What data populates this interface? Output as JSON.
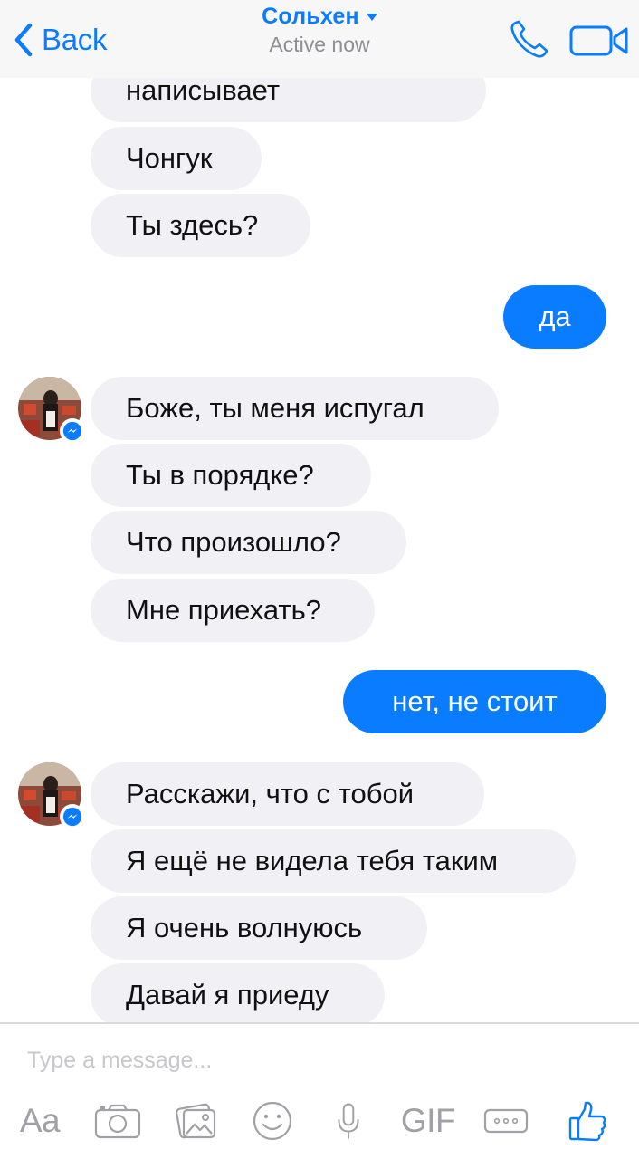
{
  "header": {
    "back_label": "Back",
    "title": "Сольхен",
    "subtitle": "Active now"
  },
  "messages": [
    {
      "side": "in",
      "text": "написывает"
    },
    {
      "side": "in",
      "text": "Чонгук"
    },
    {
      "side": "in",
      "text": "Ты здесь?"
    },
    {
      "side": "out",
      "text": "да"
    },
    {
      "side": "in",
      "text": "Боже, ты меня испугал"
    },
    {
      "side": "in",
      "text": "Ты в порядке?"
    },
    {
      "side": "in",
      "text": "Что произошло?"
    },
    {
      "side": "in",
      "text": "Мне приехать?"
    },
    {
      "side": "out",
      "text": "нет, не стоит"
    },
    {
      "side": "in",
      "text": "Расскажи, что с тобой"
    },
    {
      "side": "in",
      "text": "Я ещё не видела тебя таким"
    },
    {
      "side": "in",
      "text": "Я очень волнуюсь"
    },
    {
      "side": "in",
      "text": "Давай я приеду"
    }
  ],
  "composer": {
    "placeholder": "Type a message...",
    "text_tool_label": "Aa",
    "gif_label": "GIF",
    "tools": [
      "text-format",
      "camera",
      "photo-gallery",
      "emoji",
      "microphone",
      "gif",
      "more",
      "like"
    ]
  },
  "colors": {
    "accent": "#0a7cff",
    "incoming_bubble": "#f1f0f5",
    "header_bg": "#f7f7f7",
    "icon_gray": "#a0a0a6"
  }
}
